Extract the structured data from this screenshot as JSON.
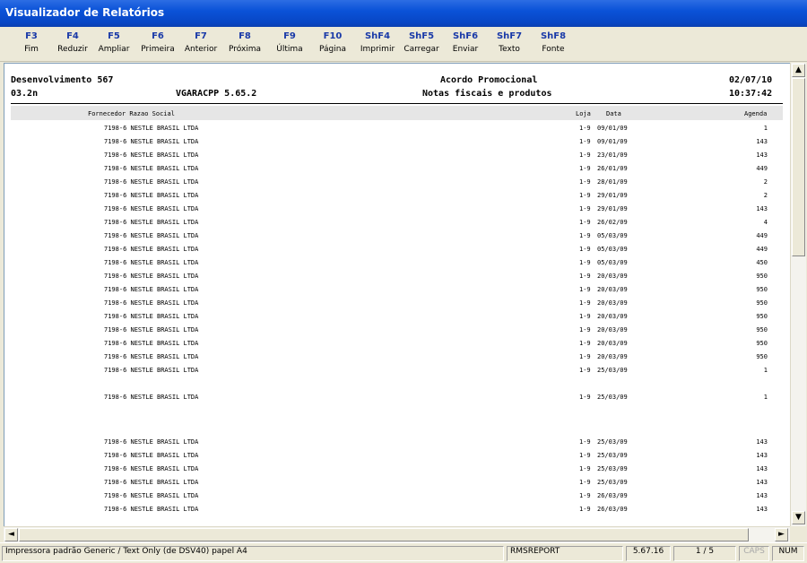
{
  "window": {
    "title": "Visualizador de Relatórios"
  },
  "toolbar": [
    {
      "key": "F3",
      "label": "Fim"
    },
    {
      "key": "F4",
      "label": "Reduzir"
    },
    {
      "key": "F5",
      "label": "Ampliar"
    },
    {
      "key": "F6",
      "label": "Primeira"
    },
    {
      "key": "F7",
      "label": "Anterior"
    },
    {
      "key": "F8",
      "label": "Próxima"
    },
    {
      "key": "F9",
      "label": "Última"
    },
    {
      "key": "F10",
      "label": "Página"
    },
    {
      "key": "ShF4",
      "label": "Imprimir"
    },
    {
      "key": "ShF5",
      "label": "Carregar"
    },
    {
      "key": "ShF6",
      "label": "Enviar"
    },
    {
      "key": "ShF7",
      "label": "Texto"
    },
    {
      "key": "ShF8",
      "label": "Fonte"
    }
  ],
  "report": {
    "company": "Desenvolvimento 567",
    "code": "03.2n",
    "program": "VGARACPP 5.65.2",
    "title": "Acordo Promocional",
    "subtitle": "Notas fiscais e produtos",
    "date": "02/07/10",
    "time": "10:37:42",
    "columns": {
      "supplier": "Fornecedor Razao Social",
      "store": "Loja",
      "date": "Data",
      "agenda": "Agenda"
    },
    "rows": [
      {
        "supplier": "7198-6 NESTLE BRASIL LTDA",
        "store": "1-9",
        "date": "09/01/09",
        "agenda": "1"
      },
      {
        "supplier": "7198-6 NESTLE BRASIL LTDA",
        "store": "1-9",
        "date": "09/01/09",
        "agenda": "143"
      },
      {
        "supplier": "7198-6 NESTLE BRASIL LTDA",
        "store": "1-9",
        "date": "23/01/09",
        "agenda": "143"
      },
      {
        "supplier": "7198-6 NESTLE BRASIL LTDA",
        "store": "1-9",
        "date": "26/01/09",
        "agenda": "449"
      },
      {
        "supplier": "7198-6 NESTLE BRASIL LTDA",
        "store": "1-9",
        "date": "28/01/09",
        "agenda": "2"
      },
      {
        "supplier": "7198-6 NESTLE BRASIL LTDA",
        "store": "1-9",
        "date": "29/01/09",
        "agenda": "2"
      },
      {
        "supplier": "7198-6 NESTLE BRASIL LTDA",
        "store": "1-9",
        "date": "29/01/09",
        "agenda": "143"
      },
      {
        "supplier": "7198-6 NESTLE BRASIL LTDA",
        "store": "1-9",
        "date": "26/02/09",
        "agenda": "4"
      },
      {
        "supplier": "7198-6 NESTLE BRASIL LTDA",
        "store": "1-9",
        "date": "05/03/09",
        "agenda": "449"
      },
      {
        "supplier": "7198-6 NESTLE BRASIL LTDA",
        "store": "1-9",
        "date": "05/03/09",
        "agenda": "449"
      },
      {
        "supplier": "7198-6 NESTLE BRASIL LTDA",
        "store": "1-9",
        "date": "05/03/09",
        "agenda": "450"
      },
      {
        "supplier": "7198-6 NESTLE BRASIL LTDA",
        "store": "1-9",
        "date": "20/03/09",
        "agenda": "950"
      },
      {
        "supplier": "7198-6 NESTLE BRASIL LTDA",
        "store": "1-9",
        "date": "20/03/09",
        "agenda": "950"
      },
      {
        "supplier": "7198-6 NESTLE BRASIL LTDA",
        "store": "1-9",
        "date": "20/03/09",
        "agenda": "950"
      },
      {
        "supplier": "7198-6 NESTLE BRASIL LTDA",
        "store": "1-9",
        "date": "20/03/09",
        "agenda": "950"
      },
      {
        "supplier": "7198-6 NESTLE BRASIL LTDA",
        "store": "1-9",
        "date": "20/03/09",
        "agenda": "950"
      },
      {
        "supplier": "7198-6 NESTLE BRASIL LTDA",
        "store": "1-9",
        "date": "20/03/09",
        "agenda": "950"
      },
      {
        "supplier": "7198-6 NESTLE BRASIL LTDA",
        "store": "1-9",
        "date": "20/03/09",
        "agenda": "950"
      },
      {
        "supplier": "7198-6 NESTLE BRASIL LTDA",
        "store": "1-9",
        "date": "25/03/09",
        "agenda": "1"
      },
      {
        "supplier": "7198-6 NESTLE BRASIL LTDA",
        "store": "1-9",
        "date": "25/03/09",
        "agenda": "1"
      },
      {
        "supplier": "7198-6 NESTLE BRASIL LTDA",
        "store": "1-9",
        "date": "25/03/09",
        "agenda": "143"
      },
      {
        "supplier": "7198-6 NESTLE BRASIL LTDA",
        "store": "1-9",
        "date": "25/03/09",
        "agenda": "143"
      },
      {
        "supplier": "7198-6 NESTLE BRASIL LTDA",
        "store": "1-9",
        "date": "25/03/09",
        "agenda": "143"
      },
      {
        "supplier": "7198-6 NESTLE BRASIL LTDA",
        "store": "1-9",
        "date": "25/03/09",
        "agenda": "143"
      },
      {
        "supplier": "7198-6 NESTLE BRASIL LTDA",
        "store": "1-9",
        "date": "26/03/09",
        "agenda": "143"
      },
      {
        "supplier": "7198-6 NESTLE BRASIL LTDA",
        "store": "1-9",
        "date": "26/03/09",
        "agenda": "143"
      }
    ]
  },
  "scroll": {
    "up": "▲",
    "down": "▼",
    "left": "◄",
    "right": "►"
  },
  "status": {
    "printer": "Impressora padrão Generic / Text Only (de DSV40) papel A4",
    "module": "RMSREPORT",
    "version": "5.67.16",
    "page": "1 / 5",
    "caps": "CAPS",
    "num": "NUM"
  }
}
